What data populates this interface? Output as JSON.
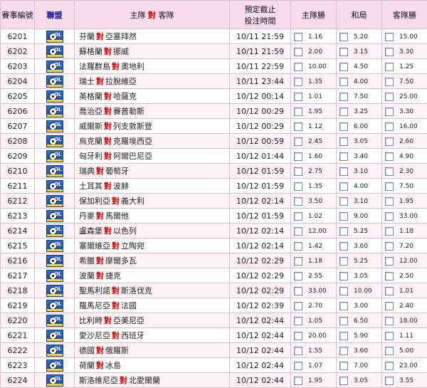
{
  "header": {
    "match_no": "賽事編號",
    "league": "聯盟",
    "teams_home": "主隊",
    "teams_vs": "對",
    "teams_away": "客隊",
    "time_line1": "預定截止",
    "time_line2": "投注時間",
    "home_win": "主隊勝",
    "draw": "和局",
    "away_win": "客隊勝"
  },
  "league_icon": "soccer-league-icon",
  "colors": {
    "header_bg": "#f9dcea",
    "vs_red": "#d00000",
    "league_text": "#1010a0"
  },
  "rows": [
    {
      "no": "6201",
      "home": "芬蘭",
      "away": "亞塞拜然",
      "time": "10/11 21:59",
      "h": "1.16",
      "d": "5.20",
      "a": "15.00"
    },
    {
      "no": "6202",
      "home": "蘇格蘭",
      "away": "挪威",
      "time": "10/11 21:59",
      "h": "2.00",
      "d": "3.15",
      "a": "3.30"
    },
    {
      "no": "6203",
      "home": "法羅群島",
      "away": "奧地利",
      "time": "10/11 22:59",
      "h": "10.00",
      "d": "4.50",
      "a": "1.25"
    },
    {
      "no": "6204",
      "home": "瑞士",
      "away": "拉脫維亞",
      "time": "10/11 23:44",
      "h": "1.35",
      "d": "4.00",
      "a": "7.50"
    },
    {
      "no": "6205",
      "home": "英格蘭",
      "away": "哈薩克",
      "time": "10/12 00:14",
      "h": "1.01",
      "d": "7.50",
      "a": "25.00"
    },
    {
      "no": "6206",
      "home": "喬治亞",
      "away": "賽普勒斯",
      "time": "10/12 00:29",
      "h": "1.95",
      "d": "3.25",
      "a": "3.30"
    },
    {
      "no": "6207",
      "home": "威爾斯",
      "away": "列支敦斯登",
      "time": "10/12 00:29",
      "h": "1.12",
      "d": "6.00",
      "a": "16.00"
    },
    {
      "no": "6208",
      "home": "烏克蘭",
      "away": "克羅埃西亞",
      "time": "10/12 00:59",
      "h": "2.45",
      "d": "3.05",
      "a": "2.60"
    },
    {
      "no": "6209",
      "home": "匈牙利",
      "away": "阿爾巴尼亞",
      "time": "10/12 01:44",
      "h": "1.60",
      "d": "3.40",
      "a": "4.90"
    },
    {
      "no": "6210",
      "home": "瑞典",
      "away": "葡萄牙",
      "time": "10/12 01:59",
      "h": "2.75",
      "d": "3.10",
      "a": "2.30"
    },
    {
      "no": "6211",
      "home": "土耳其",
      "away": "波赫",
      "time": "10/12 01:59",
      "h": "1.35",
      "d": "4.00",
      "a": "7.50"
    },
    {
      "no": "6212",
      "home": "保加利亞",
      "away": "義大利",
      "time": "10/12 02:14",
      "h": "3.50",
      "d": "3.10",
      "a": "1.95"
    },
    {
      "no": "6213",
      "home": "丹麥",
      "away": "馬爾他",
      "time": "10/12 01:59",
      "h": "1.02",
      "d": "9.00",
      "a": "33.00"
    },
    {
      "no": "6214",
      "home": "盧森堡",
      "away": "以色列",
      "time": "10/12 02:14",
      "h": "12.00",
      "d": "5.25",
      "a": "1.18"
    },
    {
      "no": "6215",
      "home": "塞爾維亞",
      "away": "立陶宛",
      "time": "10/12 02:14",
      "h": "1.42",
      "d": "3.60",
      "a": "7.20"
    },
    {
      "no": "6216",
      "home": "希臘",
      "away": "摩爾多瓦",
      "time": "10/12 02:29",
      "h": "1.18",
      "d": "5.25",
      "a": "12.00"
    },
    {
      "no": "6217",
      "home": "波蘭",
      "away": "捷克",
      "time": "10/12 02:29",
      "h": "2.55",
      "d": "3.05",
      "a": "2.50"
    },
    {
      "no": "6218",
      "home": "聖馬利諾",
      "away": "斯洛伐克",
      "time": "10/12 02:29",
      "h": "33.00",
      "d": "10.00",
      "a": "1.01"
    },
    {
      "no": "6219",
      "home": "羅馬尼亞",
      "away": "法國",
      "time": "10/12 02:39",
      "h": "2.70",
      "d": "3.00",
      "a": "2.40"
    },
    {
      "no": "6220",
      "home": "比利時",
      "away": "亞美尼亞",
      "time": "10/12 02:44",
      "h": "1.05",
      "d": "6.50",
      "a": "18.00"
    },
    {
      "no": "6221",
      "home": "愛沙尼亞",
      "away": "西班牙",
      "time": "10/12 02:44",
      "h": "20.00",
      "d": "5.90",
      "a": "1.11"
    },
    {
      "no": "6222",
      "home": "德國",
      "away": "俄羅斯",
      "time": "10/12 02:44",
      "h": "1.55",
      "d": "3.60",
      "a": "5.00"
    },
    {
      "no": "6223",
      "home": "荷蘭",
      "away": "冰島",
      "time": "10/12 02:44",
      "h": "1.07",
      "d": "7.00",
      "a": "23.00"
    },
    {
      "no": "6224",
      "home": "斯洛維尼亞",
      "away": "北愛爾蘭",
      "time": "10/12 02:44",
      "h": "1.95",
      "d": "3.05",
      "a": "3.55"
    }
  ]
}
